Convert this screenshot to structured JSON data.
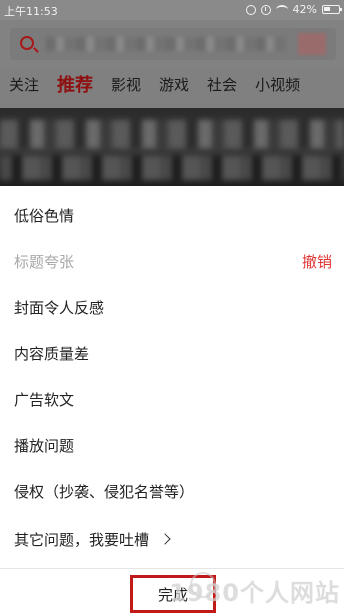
{
  "status_bar": {
    "time": "上午11:53",
    "battery": "42%",
    "icons": [
      "alarm-icon",
      "clock-icon",
      "wifi-icon",
      "battery-icon"
    ]
  },
  "search": {
    "icon": "search-icon"
  },
  "tabs": [
    {
      "label": "关注",
      "active": false
    },
    {
      "label": "推荐",
      "active": true
    },
    {
      "label": "影视",
      "active": false
    },
    {
      "label": "游戏",
      "active": false
    },
    {
      "label": "社会",
      "active": false
    },
    {
      "label": "小视频",
      "active": false
    }
  ],
  "report_sheet": {
    "items": [
      {
        "label": "低俗色情",
        "state": "normal"
      },
      {
        "label": "标题夸张",
        "state": "selected"
      },
      {
        "label": "封面令人反感",
        "state": "normal"
      },
      {
        "label": "内容质量差",
        "state": "normal"
      },
      {
        "label": "广告软文",
        "state": "normal"
      },
      {
        "label": "播放问题",
        "state": "normal"
      },
      {
        "label": "侵权（抄袭、侵犯名誉等）",
        "state": "normal"
      },
      {
        "label": "其它问题，我要吐槽",
        "state": "normal"
      }
    ],
    "undo_label": "撤销",
    "done_label": "完成"
  },
  "watermark": {
    "text": "1980个人网站"
  },
  "colors": {
    "accent": "#e03535",
    "highlight_box": "#c21818",
    "overlay_dim": "#808080"
  }
}
